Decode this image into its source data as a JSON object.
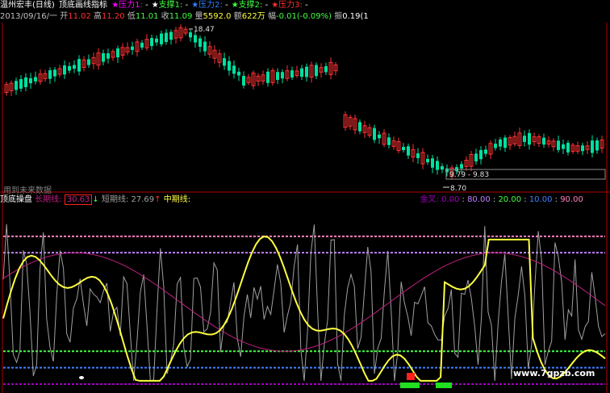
{
  "header": {
    "stock_name": "温州宏丰(日线)",
    "indicator_name": "顶底画线指标",
    "items": [
      {
        "label": "压力1:",
        "value": "-",
        "color": "#ff00ff",
        "star_color": "#ff00ff"
      },
      {
        "label": "支撑1:",
        "value": "-",
        "color": "#40ff40",
        "star_color": "#ffffff"
      },
      {
        "label": "压力2:",
        "value": "-",
        "color": "#3080ff",
        "star_color": "#3080ff"
      },
      {
        "label": "支撑2:",
        "value": "-",
        "color": "#40ff40",
        "star_color": "#40ff40"
      },
      {
        "label": "压力3:",
        "value": "-",
        "color": "#ff3030",
        "star_color": "#ff3030"
      }
    ]
  },
  "ohlc": {
    "date": "2013/09/16/一",
    "open_label": "开",
    "open": "11.02",
    "high_label": "高",
    "high": "11.20",
    "low_label": "低",
    "low": "11.01",
    "close_label": "收",
    "close": "11.09",
    "volume_label": "量",
    "volume": "5592.0",
    "amount_label": "额",
    "amount": "622万",
    "change_label": "幅",
    "change": "-0.01(-0.09%)",
    "swing_label": "振",
    "swing": "0.19(1"
  },
  "annotations": {
    "high_mark": "18.47",
    "low_mark": "8.70",
    "range_box": "9.79 - 9.83",
    "future_data": "用到未来数据"
  },
  "indicator": {
    "name": "顶底操盘",
    "long_label": "长期线:",
    "long_value": "30.63",
    "short_label": "短期线:",
    "short_value": "27.69",
    "mid_label": "中期线:",
    "levels_label": "金叉:",
    "levels": [
      "0.00",
      "80.00",
      "20.00",
      "10.00",
      "90.00"
    ]
  },
  "watermark": "www.7gpzb.com",
  "colors": {
    "up": "#ff3232",
    "down": "#00e0a0",
    "short_line": "#ffff40",
    "long_line": "#c02080",
    "noise_line": "#a0a0a0",
    "level_90": "#ff80c0",
    "level_80": "#c080ff",
    "level_20": "#40ff40",
    "level_10": "#4080ff",
    "level_0": "#a000c0"
  },
  "chart_data": [
    {
      "type": "candlestick",
      "title": "温州宏丰(日线)",
      "annotations": [
        {
          "text": "18.47",
          "kind": "high"
        },
        {
          "text": "8.70",
          "kind": "low"
        },
        {
          "text": "9.79 - 9.83",
          "kind": "range"
        }
      ]
    },
    {
      "type": "line",
      "title": "顶底操盘",
      "series": [
        {
          "name": "长期线",
          "last": 30.63
        },
        {
          "name": "短期线",
          "last": 27.69
        },
        {
          "name": "中期线"
        }
      ],
      "ylim": [
        0,
        100
      ],
      "reference_lines": [
        90,
        80,
        20,
        10,
        0
      ]
    }
  ]
}
